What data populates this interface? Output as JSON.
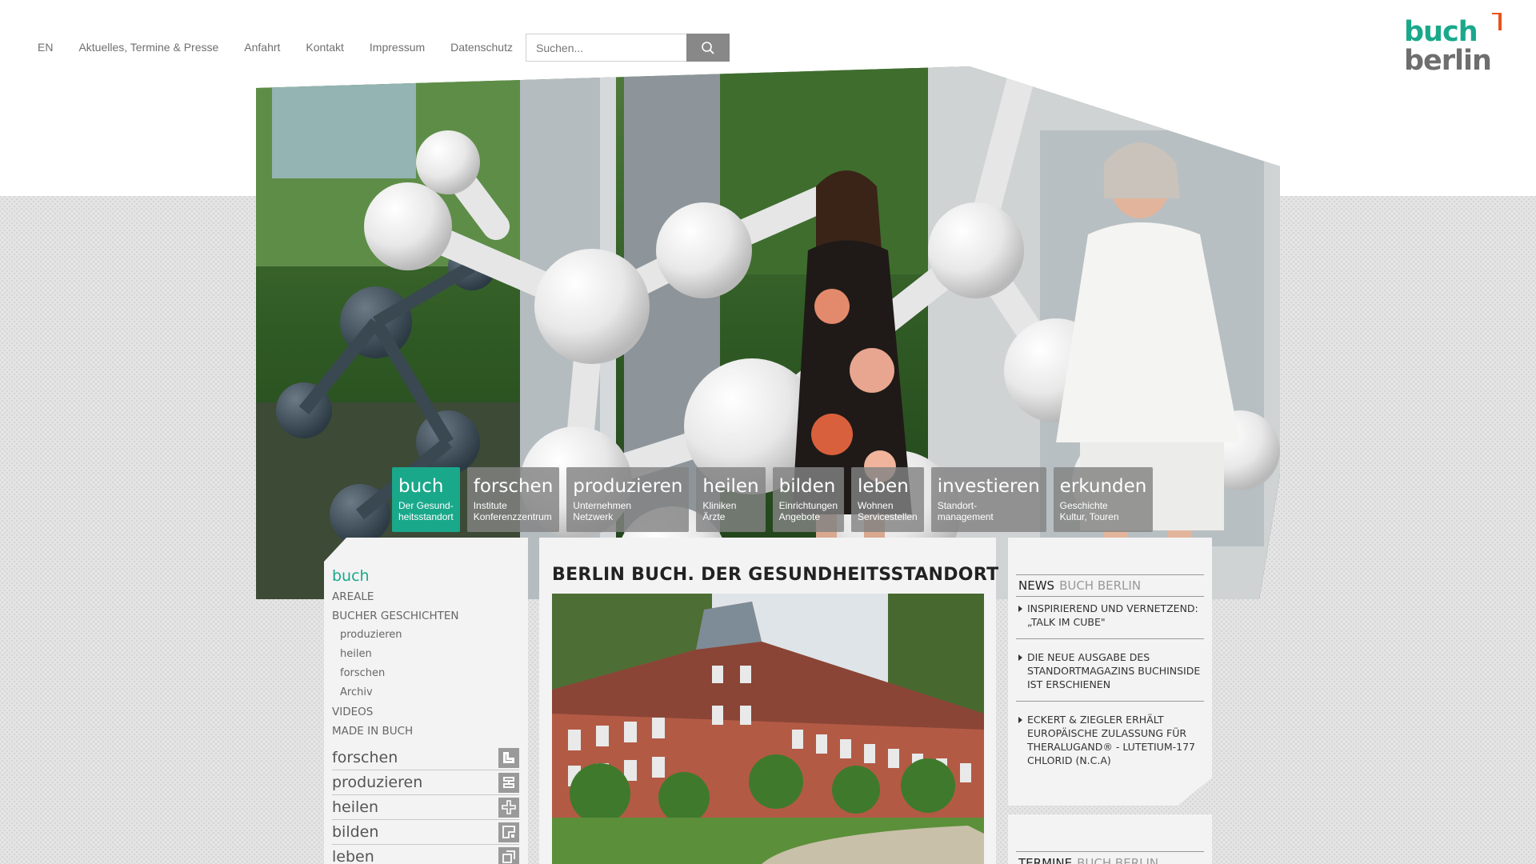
{
  "topnav": {
    "items": [
      "EN",
      "Aktuelles, Termine & Presse",
      "Anfahrt",
      "Kontakt",
      "Impressum",
      "Datenschutz"
    ]
  },
  "search": {
    "placeholder": "Suchen...",
    "icon": "search-icon"
  },
  "logo": {
    "line1": "buch",
    "line2": "berlin"
  },
  "colors": {
    "accent": "#1aa88b",
    "gray": "#828282",
    "logo_orange": "#e8531c"
  },
  "categories": [
    {
      "title": "buch",
      "sub1": "Der Gesund-",
      "sub2": "heitsstandort",
      "active": true
    },
    {
      "title": "forschen",
      "sub1": "Institute",
      "sub2": "Konferenzzentrum",
      "active": false
    },
    {
      "title": "produzieren",
      "sub1": "Unternehmen",
      "sub2": "Netzwerk",
      "active": false
    },
    {
      "title": "heilen",
      "sub1": "Kliniken",
      "sub2": "Ärzte",
      "active": false
    },
    {
      "title": "bilden",
      "sub1": "Einrichtungen",
      "sub2": "Angebote",
      "active": false
    },
    {
      "title": "leben",
      "sub1": "Wohnen",
      "sub2": "Servicestellen",
      "active": false
    },
    {
      "title": "investieren",
      "sub1": "Standort-",
      "sub2": "management",
      "active": false
    },
    {
      "title": "erkunden",
      "sub1": "Geschichte",
      "sub2": "Kultur, Touren",
      "active": false
    }
  ],
  "sidemenu": {
    "head": "buch",
    "top1": "AREALE",
    "top2": "BUCHER GESCHICHTEN",
    "subs": [
      "produzieren",
      "heilen",
      "forschen",
      "Archiv"
    ],
    "top3": "VIDEOS",
    "top4": "MADE IN BUCH",
    "cats": [
      "forschen",
      "produzieren",
      "heilen",
      "bilden",
      "leben"
    ]
  },
  "main": {
    "title": "BERLIN BUCH. DER GESUNDHEITSSTANDORT"
  },
  "news": {
    "head_a": "NEWS",
    "head_b": "BUCH BERLIN",
    "items": [
      "INSPIRIEREND UND VERNETZEND: „TALK IM CUBE\"",
      "DIE NEUE AUSGABE DES STANDORTMAGAZINS BUCHINSIDE IST ERSCHIENEN",
      "ECKERT & ZIEGLER ERHÄLT EUROPÄISCHE ZULASSUNG FÜR THERALUGAND® - LUTETIUM-177 CHLORID (N.C.A)"
    ]
  },
  "termine": {
    "head_a": "TERMINE",
    "head_b": "BUCH BERLIN"
  }
}
